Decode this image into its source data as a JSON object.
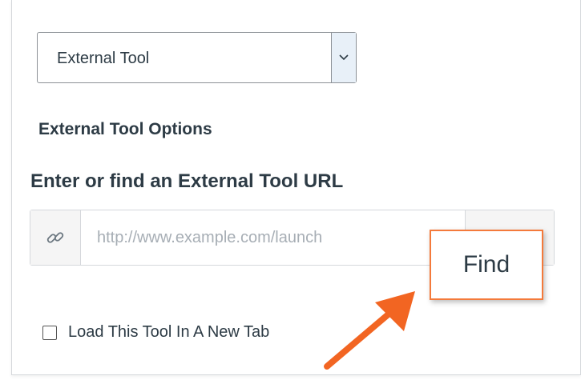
{
  "select": {
    "value": "External Tool",
    "chevron": "chevron-down-icon"
  },
  "options_heading": "External Tool Options",
  "url": {
    "heading": "Enter or find an External Tool URL",
    "placeholder": "http://www.example.com/launch",
    "value": "",
    "link_icon": "link-icon",
    "find_label_partial": "Find"
  },
  "callout": {
    "label": "Find",
    "border_color": "#f47a3b"
  },
  "checkbox": {
    "label": "Load This Tool In A New Tab",
    "checked": false
  },
  "arrow": {
    "icon": "arrow-icon",
    "color": "#f26522"
  }
}
